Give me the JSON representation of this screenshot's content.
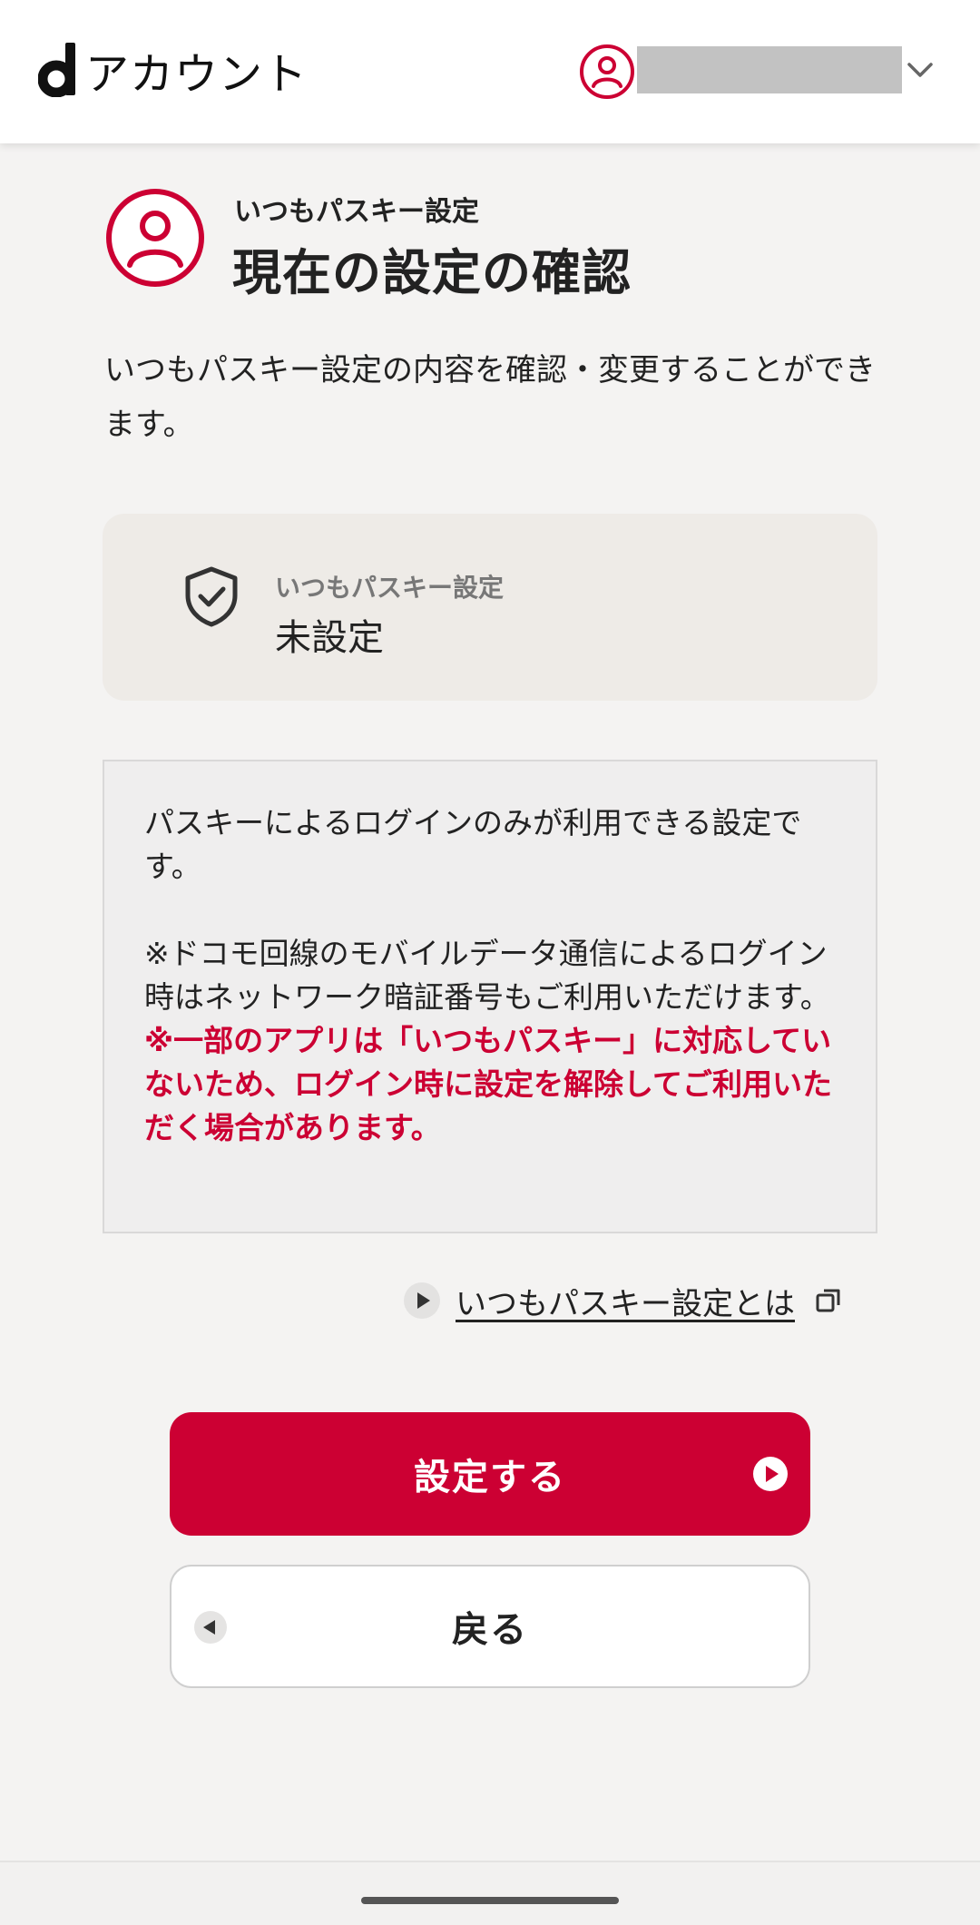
{
  "header": {
    "brand_letter": "d",
    "brand_name": "アカウント",
    "account_icon": "user-circle-icon",
    "chevron_icon": "chevron-down-icon"
  },
  "title": {
    "icon": "user-circle-icon",
    "subtitle": "いつもパスキー設定",
    "main": "現在の設定の確認"
  },
  "description": "いつもパスキー設定の内容を確認・変更することができます。",
  "status": {
    "icon": "shield-check-icon",
    "label": "いつもパスキー設定",
    "value": "未設定"
  },
  "info": {
    "paragraph1": "パスキーによるログインのみが利用できる設定です。",
    "paragraph2": "※ドコモ回線のモバイルデータ通信によるログイン時はネットワーク暗証番号もご利用いただけます。",
    "warning": "※一部のアプリは「いつもパスキー」に対応していないため、ログイン時に設定を解除してご利用いただく場合があります。"
  },
  "about_link": {
    "text": "いつもパスキー設定とは",
    "icon": "play-circle-icon",
    "external_icon": "external-window-icon"
  },
  "buttons": {
    "primary_label": "設定する",
    "secondary_label": "戻る"
  },
  "colors": {
    "accent": "#cc0033",
    "background": "#f4f3f2",
    "card": "#eeebe7",
    "text": "#222222"
  }
}
